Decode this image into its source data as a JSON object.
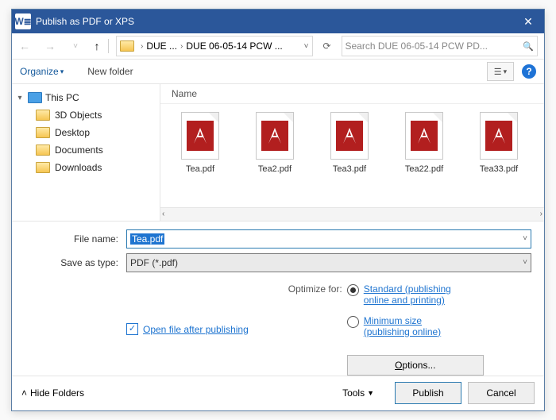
{
  "titlebar": {
    "title": "Publish as PDF or XPS"
  },
  "nav": {
    "up_glyph": "↑",
    "refresh_glyph": "⟳",
    "drop_glyph": "˅",
    "breadcrumb": {
      "seg1": "DUE ...",
      "seg2": "DUE 06-05-14 PCW ..."
    },
    "search_placeholder": "Search DUE 06-05-14 PCW PD...",
    "search_glyph": "🔍"
  },
  "toolbar": {
    "organize": "Organize",
    "new_folder": "New folder",
    "view_drop_glyph": "▾",
    "help_glyph": "?"
  },
  "tree": {
    "this_pc": "This PC",
    "items": [
      {
        "label": "3D Objects"
      },
      {
        "label": "Desktop"
      },
      {
        "label": "Documents"
      },
      {
        "label": "Downloads"
      }
    ]
  },
  "filelist": {
    "column": "Name",
    "files": [
      {
        "name": "Tea.pdf"
      },
      {
        "name": "Tea2.pdf"
      },
      {
        "name": "Tea3.pdf"
      },
      {
        "name": "Tea22.pdf"
      },
      {
        "name": "Tea33.pdf"
      }
    ]
  },
  "filename": {
    "label": "File name:",
    "value": "Tea.pdf"
  },
  "savetype": {
    "label": "Save as type:",
    "value": "PDF (*.pdf)"
  },
  "open_after": {
    "label": "Open file after publishing",
    "checked": true
  },
  "optimize": {
    "label": "Optimize for:",
    "standard_line1": "Standard (publishing",
    "standard_line2": "online and printing)",
    "min_line1": "Minimum size",
    "min_line2": "(publishing online)"
  },
  "options_btn": "Options...",
  "footer": {
    "hide": "Hide Folders",
    "tools": "Tools",
    "publish": "Publish",
    "cancel": "Cancel"
  },
  "word_glyph": "W≣"
}
